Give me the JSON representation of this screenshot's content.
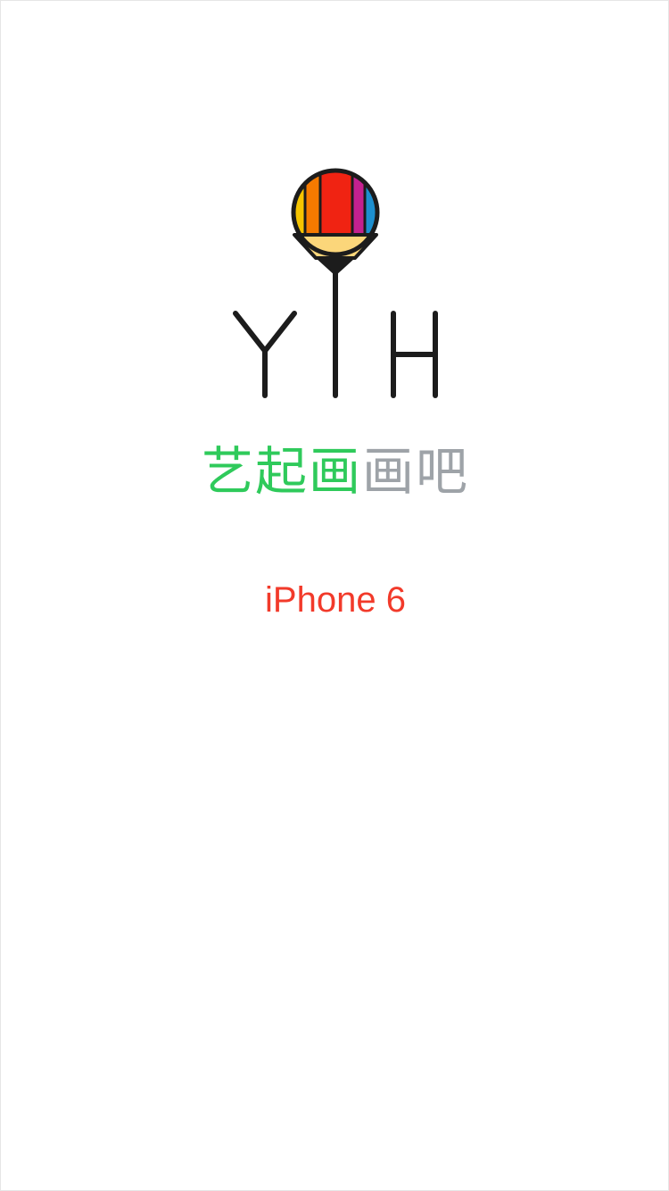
{
  "splash": {
    "logo": {
      "icon": "pencil-balloon-logo",
      "letters": [
        "Y",
        "H"
      ]
    },
    "app_name": {
      "green_part": "艺起画",
      "gray_part": "画吧"
    },
    "device_label": "iPhone 6"
  },
  "colors": {
    "green": "#2fca5b",
    "gray": "#9ea3a8",
    "red": "#f23a2a",
    "logo_stroke": "#1c1c1c"
  }
}
